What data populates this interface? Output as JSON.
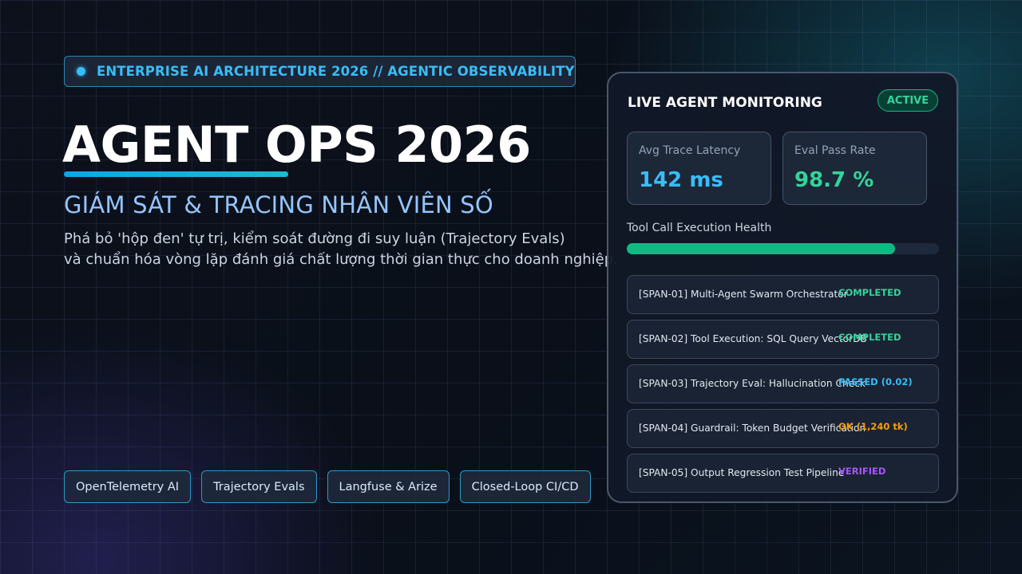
{
  "tagline": "ENTERPRISE AI ARCHITECTURE 2026 // AGENTIC OBSERVABILITY",
  "hero": {
    "title": "AGENT OPS 2026",
    "subtitle": "GIÁM SÁT & TRACING NHÂN VIÊN SỐ",
    "description_lines": [
      "Phá bỏ 'hộp đen' tự trị, kiểm soát đường đi suy luận (Trajectory Evals)",
      "và chuẩn hóa vòng lặp đánh giá chất lượng thời gian thực cho doanh nghiệp."
    ]
  },
  "chips": [
    "OpenTelemetry AI",
    "Trajectory Evals",
    "Langfuse & Arize",
    "Closed-Loop CI/CD"
  ],
  "panel": {
    "title": "LIVE AGENT MONITORING",
    "badge": "ACTIVE",
    "metrics": [
      {
        "label": "Avg Trace Latency",
        "value": "142 ms"
      },
      {
        "label": "Eval Pass Rate",
        "value": "98.7 %"
      }
    ],
    "health_label": "Tool Call Execution Health",
    "health_fraction": 0.86,
    "spans": [
      {
        "name": "[SPAN-01] Multi-Agent Swarm Orchestrator",
        "status": "COMPLETED",
        "color": "#34d399"
      },
      {
        "name": "[SPAN-02] Tool Execution: SQL Query VectorDB",
        "status": "COMPLETED",
        "color": "#34d399"
      },
      {
        "name": "[SPAN-03] Trajectory Eval: Hallucination Check",
        "status": "PASSED (0.02)",
        "color": "#38bdf8"
      },
      {
        "name": "[SPAN-04] Guardrail: Token Budget Verification",
        "status": "OK (1,240 tk)",
        "color": "#f59e0b"
      },
      {
        "name": "[SPAN-05] Output Regression Test Pipeline",
        "status": "VERIFIED",
        "color": "#a855f7"
      }
    ]
  },
  "colors": {
    "accent": "#38bdf8",
    "success": "#34d399",
    "warning": "#f59e0b",
    "verified": "#a855f7",
    "subtitle": "#93c5fd"
  }
}
